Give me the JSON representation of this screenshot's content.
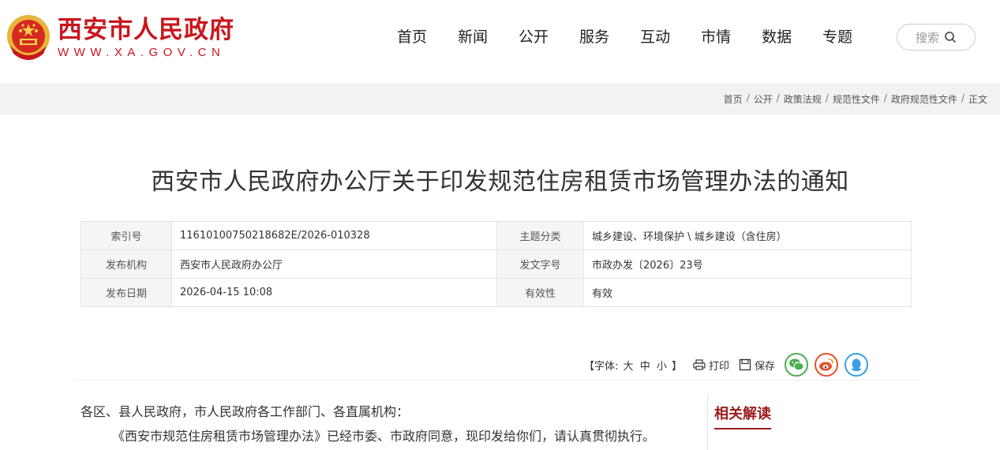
{
  "header": {
    "site_title": "西安市人民政府",
    "site_url": "WWW.XA.GOV.CN",
    "nav": [
      "首页",
      "新闻",
      "公开",
      "服务",
      "互动",
      "市情",
      "数据",
      "专题"
    ],
    "search_label": "搜索"
  },
  "breadcrumb": [
    "首页",
    "公开",
    "政策法规",
    "规范性文件",
    "政府规范性文件",
    "正文"
  ],
  "article": {
    "title": "西安市人民政府办公厅关于印发规范住房租赁市场管理办法的通知"
  },
  "meta": {
    "index_label": "索引号",
    "index_value": "11610100750218682E/2026-010328",
    "topic_label": "主题分类",
    "topic_value": "城乡建设、环境保护 \\ 城乡建设（含住房）",
    "org_label": "发布机构",
    "org_value": "西安市人民政府办公厅",
    "doc_no_label": "发文字号",
    "doc_no_value": "市政办发〔2026〕23号",
    "date_label": "发布日期",
    "date_value": "2026-04-15 10:08",
    "validity_label": "有效性",
    "validity_value": "有效"
  },
  "tools": {
    "font_prefix": "【字体:",
    "large": "大",
    "medium": "中",
    "small": "小",
    "font_suffix": "】",
    "print": "打印",
    "save": "保存"
  },
  "body": {
    "salutation": "各区、县人民政府，市人民政府各工作部门、各直属机构：",
    "para1": "《西安市规范住房租赁市场管理办法》已经市委、市政府同意，现印发给你们，请认真贯彻执行。"
  },
  "sidebar": {
    "title": "相关解读"
  },
  "colors": {
    "brand_red": "#c8161d",
    "wechat": "#4caf50",
    "weibo": "#e6512c",
    "qq": "#3a9ee4"
  }
}
